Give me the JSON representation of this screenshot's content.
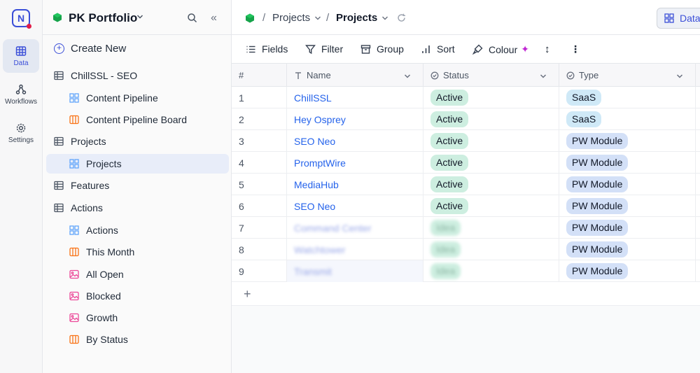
{
  "rail": {
    "logo": "N",
    "items": [
      {
        "label": "Data",
        "icon": "grid-icon"
      },
      {
        "label": "Workflows",
        "icon": "workflow-icon"
      },
      {
        "label": "Settings",
        "icon": "gear-icon"
      }
    ]
  },
  "sidebar": {
    "title": "PK Portfolio",
    "create_label": "Create New",
    "items": [
      {
        "label": "ChillSSL - SEO",
        "level": 1,
        "icon": "table-icon"
      },
      {
        "label": "Content Pipeline",
        "level": 2,
        "icon": "gallery-icon"
      },
      {
        "label": "Content Pipeline Board",
        "level": 2,
        "icon": "kanban-icon"
      },
      {
        "label": "Projects",
        "level": 1,
        "icon": "table-icon"
      },
      {
        "label": "Projects",
        "level": 2,
        "icon": "gallery-icon",
        "selected": true
      },
      {
        "label": "Features",
        "level": 1,
        "icon": "table-icon"
      },
      {
        "label": "Actions",
        "level": 1,
        "icon": "table-icon"
      },
      {
        "label": "Actions",
        "level": 2,
        "icon": "gallery-icon"
      },
      {
        "label": "This Month",
        "level": 2,
        "icon": "kanban-icon"
      },
      {
        "label": "All Open",
        "level": 2,
        "icon": "image-icon"
      },
      {
        "label": "Blocked",
        "level": 2,
        "icon": "image-icon"
      },
      {
        "label": "Growth",
        "level": 2,
        "icon": "image-icon"
      },
      {
        "label": "By Status",
        "level": 2,
        "icon": "kanban-icon"
      }
    ]
  },
  "breadcrumb": {
    "sep": "/",
    "parent": "Projects",
    "current": "Projects"
  },
  "top_button": "Data",
  "toolbar": {
    "fields": "Fields",
    "filter": "Filter",
    "group": "Group",
    "sort": "Sort",
    "colour": "Colour",
    "more": "⋮"
  },
  "table": {
    "columns": [
      "#",
      "Name",
      "Status",
      "Type"
    ],
    "rows": [
      {
        "n": "1",
        "name": "ChillSSL",
        "status": "Active",
        "type": "SaaS"
      },
      {
        "n": "2",
        "name": "Hey Osprey",
        "status": "Active",
        "type": "SaaS"
      },
      {
        "n": "3",
        "name": "SEO Neo",
        "status": "Active",
        "type": "PW Module"
      },
      {
        "n": "4",
        "name": "PromptWire",
        "status": "Active",
        "type": "PW Module"
      },
      {
        "n": "5",
        "name": "MediaHub",
        "status": "Active",
        "type": "PW Module"
      },
      {
        "n": "6",
        "name": "SEO Neo",
        "status": "Active",
        "type": "PW Module"
      },
      {
        "n": "7",
        "name": "Command Center",
        "status": "Idea",
        "type": "PW Module",
        "blurred": true
      },
      {
        "n": "8",
        "name": "Watchtower",
        "status": "Idea",
        "type": "PW Module",
        "blurred": true
      },
      {
        "n": "9",
        "name": "Transmit",
        "status": "Idea",
        "type": "PW Module",
        "blurred": true
      }
    ],
    "add_row": "+"
  },
  "colors": {
    "accent": "#3b4fd8",
    "link": "#2563eb",
    "status_bg": "#cdeee0",
    "type_bg": "#d3e0f7"
  }
}
